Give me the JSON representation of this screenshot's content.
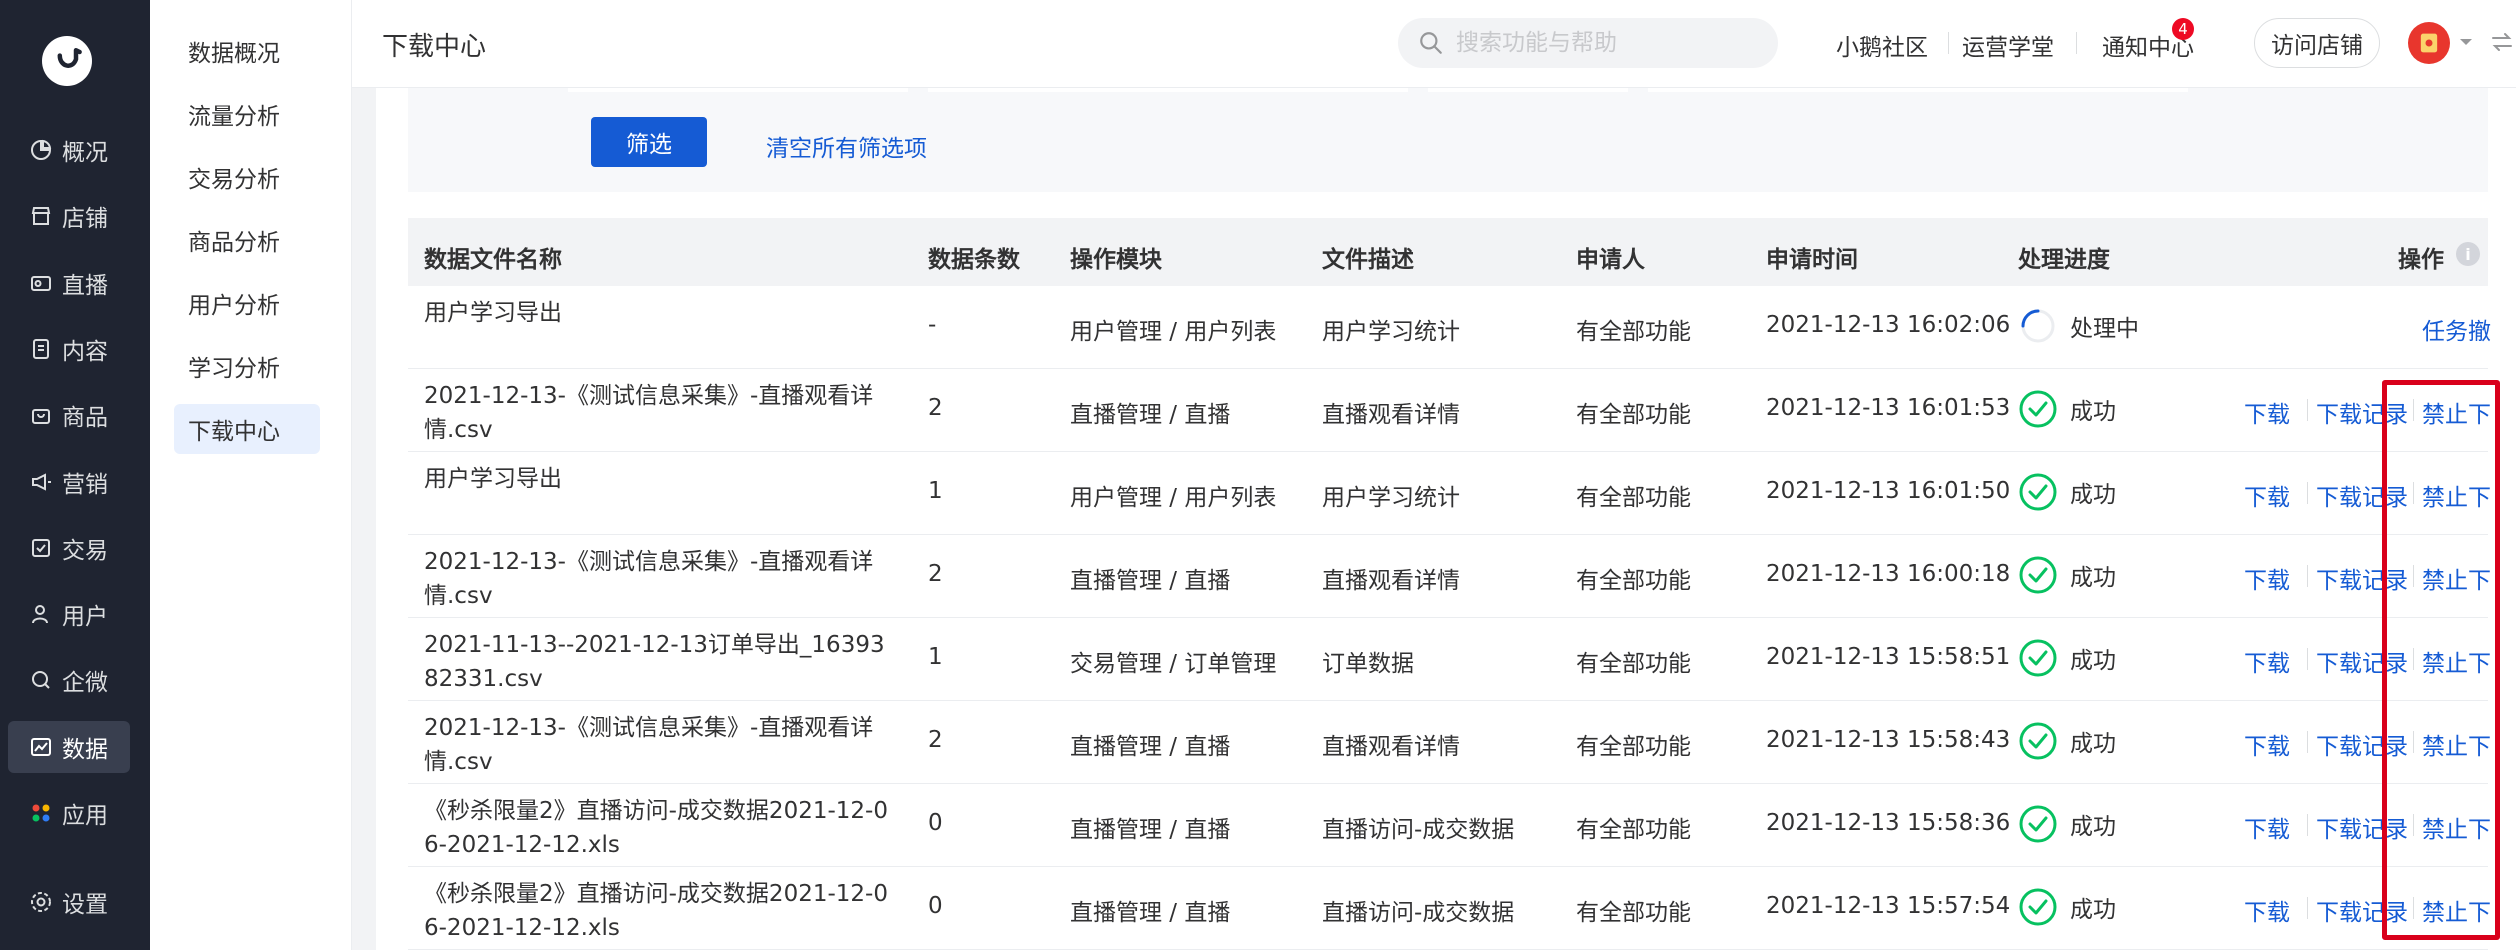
{
  "nav": {
    "items": [
      {
        "label": "概况",
        "icon": "pie-chart-icon"
      },
      {
        "label": "店铺",
        "icon": "shop-icon"
      },
      {
        "label": "直播",
        "icon": "live-icon"
      },
      {
        "label": "内容",
        "icon": "document-icon"
      },
      {
        "label": "商品",
        "icon": "bag-icon"
      },
      {
        "label": "营销",
        "icon": "megaphone-icon"
      },
      {
        "label": "交易",
        "icon": "receipt-icon"
      },
      {
        "label": "用户",
        "icon": "user-icon"
      },
      {
        "label": "企微",
        "icon": "wecom-icon"
      },
      {
        "label": "数据",
        "icon": "data-icon"
      },
      {
        "label": "应用",
        "icon": "apps-icon"
      }
    ],
    "settings_label": "设置",
    "active_index": 9
  },
  "subnav": {
    "items": [
      "数据概况",
      "流量分析",
      "交易分析",
      "商品分析",
      "用户分析",
      "学习分析",
      "下载中心"
    ],
    "active_index": 6
  },
  "header": {
    "title": "下载中心",
    "search_placeholder": "搜索功能与帮助",
    "links": [
      "小鹅社区",
      "运营学堂",
      "通知中心"
    ],
    "notification_count": "4",
    "visit_store_label": "访问店铺"
  },
  "filter": {
    "filter_button": "筛选",
    "clear_link": "清空所有筛选项"
  },
  "table": {
    "columns": [
      "数据文件名称",
      "数据条数",
      "操作模块",
      "文件描述",
      "申请人",
      "申请时间",
      "处理进度",
      "操作"
    ],
    "rows": [
      {
        "name": "用户学习导出",
        "count": "-",
        "module": "用户管理 / 用户列表",
        "desc": "用户学习统计",
        "applicant": "有全部功能",
        "time": "2021-12-13 16:02:06",
        "status": "处理中",
        "state": "processing",
        "ops": [
          "任务撤回"
        ]
      },
      {
        "name": "2021-12-13-《测试信息采集》-直播观看详情.csv",
        "count": "2",
        "module": "直播管理 / 直播",
        "desc": "直播观看详情",
        "applicant": "有全部功能",
        "time": "2021-12-13 16:01:53",
        "status": "成功",
        "state": "success",
        "ops": [
          "下载",
          "下载记录",
          "禁止下载"
        ]
      },
      {
        "name": "用户学习导出",
        "count": "1",
        "module": "用户管理 / 用户列表",
        "desc": "用户学习统计",
        "applicant": "有全部功能",
        "time": "2021-12-13 16:01:50",
        "status": "成功",
        "state": "success",
        "ops": [
          "下载",
          "下载记录",
          "禁止下载"
        ]
      },
      {
        "name": "2021-12-13-《测试信息采集》-直播观看详情.csv",
        "count": "2",
        "module": "直播管理 / 直播",
        "desc": "直播观看详情",
        "applicant": "有全部功能",
        "time": "2021-12-13 16:00:18",
        "status": "成功",
        "state": "success",
        "ops": [
          "下载",
          "下载记录",
          "禁止下载"
        ]
      },
      {
        "name": "2021-11-13--2021-12-13订单导出_1639382331.csv",
        "count": "1",
        "module": "交易管理 / 订单管理",
        "desc": "订单数据",
        "applicant": "有全部功能",
        "time": "2021-12-13 15:58:51",
        "status": "成功",
        "state": "success",
        "ops": [
          "下载",
          "下载记录",
          "禁止下载"
        ]
      },
      {
        "name": "2021-12-13-《测试信息采集》-直播观看详情.csv",
        "count": "2",
        "module": "直播管理 / 直播",
        "desc": "直播观看详情",
        "applicant": "有全部功能",
        "time": "2021-12-13 15:58:43",
        "status": "成功",
        "state": "success",
        "ops": [
          "下载",
          "下载记录",
          "禁止下载"
        ]
      },
      {
        "name": "《秒杀限量2》直播访问-成交数据2021-12-06-2021-12-12.xls",
        "count": "0",
        "module": "直播管理 / 直播",
        "desc": "直播访问-成交数据",
        "applicant": "有全部功能",
        "time": "2021-12-13 15:58:36",
        "status": "成功",
        "state": "success",
        "ops": [
          "下载",
          "下载记录",
          "禁止下载"
        ]
      },
      {
        "name": "《秒杀限量2》直播访问-成交数据2021-12-06-2021-12-12.xls",
        "count": "0",
        "module": "直播管理 / 直播",
        "desc": "直播访问-成交数据",
        "applicant": "有全部功能",
        "time": "2021-12-13 15:57:54",
        "status": "成功",
        "state": "success",
        "ops": [
          "下载",
          "下载记录",
          "禁止下载"
        ]
      }
    ]
  },
  "colors": {
    "accent": "#155bd4",
    "success": "#07c160",
    "highlight": "#d9001b",
    "sidebar": "#1f2431"
  }
}
